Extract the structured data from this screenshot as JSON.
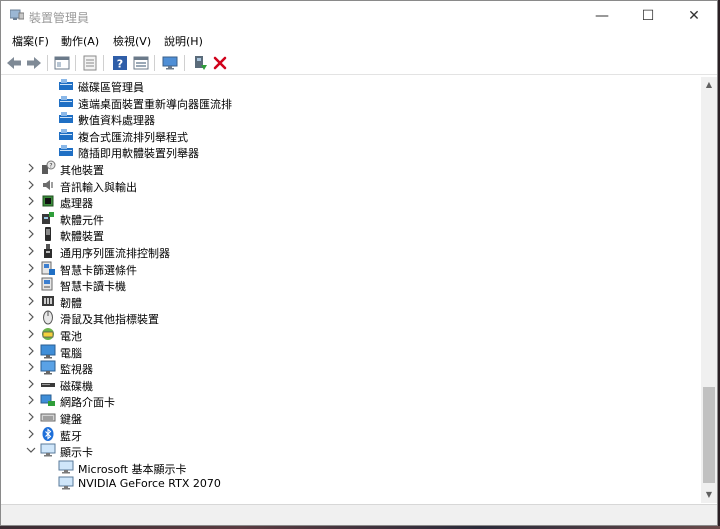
{
  "window": {
    "title": "裝置管理員",
    "minimize_glyph": "—",
    "maximize_glyph": "☐",
    "close_glyph": "✕"
  },
  "menu": [
    "檔案(F)",
    "動作(A)",
    "檢視(V)",
    "說明(H)"
  ],
  "toolbar": {
    "icons": [
      "back-arrow-icon",
      "forward-arrow-icon",
      "show-hide-tree-icon",
      "properties-icon",
      "help-icon",
      "view-icon",
      "monitor-icon",
      "update-driver-icon",
      "uninstall-icon"
    ],
    "uninstall_color": "#d0021b"
  },
  "tree": {
    "rows": [
      {
        "label": "磁碟區管理員",
        "icon": "storage-controller-icon",
        "indent": 2,
        "chevron": "none"
      },
      {
        "label": "遠端桌面裝置重新導向器匯流排",
        "icon": "storage-controller-icon",
        "indent": 2,
        "chevron": "none"
      },
      {
        "label": "數值資料處理器",
        "icon": "storage-controller-icon",
        "indent": 2,
        "chevron": "none"
      },
      {
        "label": "複合式匯流排列舉程式",
        "icon": "storage-controller-icon",
        "indent": 2,
        "chevron": "none"
      },
      {
        "label": "隨插即用軟體裝置列舉器",
        "icon": "storage-controller-icon",
        "indent": 2,
        "chevron": "none"
      },
      {
        "label": "其他裝置",
        "icon": "unknown-device-icon",
        "indent": 1,
        "chevron": "right"
      },
      {
        "label": "音訊輸入與輸出",
        "icon": "speaker-icon",
        "indent": 1,
        "chevron": "right"
      },
      {
        "label": "處理器",
        "icon": "processor-icon",
        "indent": 1,
        "chevron": "right"
      },
      {
        "label": "軟體元件",
        "icon": "software-component-icon",
        "indent": 1,
        "chevron": "right"
      },
      {
        "label": "軟體裝置",
        "icon": "software-device-icon",
        "indent": 1,
        "chevron": "right"
      },
      {
        "label": "通用序列匯流排控制器",
        "icon": "usb-icon",
        "indent": 1,
        "chevron": "right"
      },
      {
        "label": "智慧卡篩選條件",
        "icon": "smart-card-filter-icon",
        "indent": 1,
        "chevron": "right"
      },
      {
        "label": "智慧卡讀卡機",
        "icon": "smart-card-reader-icon",
        "indent": 1,
        "chevron": "right"
      },
      {
        "label": "韌體",
        "icon": "firmware-icon",
        "indent": 1,
        "chevron": "right"
      },
      {
        "label": "滑鼠及其他指標裝置",
        "icon": "mouse-icon",
        "indent": 1,
        "chevron": "right"
      },
      {
        "label": "電池",
        "icon": "battery-icon",
        "indent": 1,
        "chevron": "right"
      },
      {
        "label": "電腦",
        "icon": "computer-icon",
        "indent": 1,
        "chevron": "right"
      },
      {
        "label": "監視器",
        "icon": "monitor-icon",
        "indent": 1,
        "chevron": "right"
      },
      {
        "label": "磁碟機",
        "icon": "disk-drive-icon",
        "indent": 1,
        "chevron": "right"
      },
      {
        "label": "網路介面卡",
        "icon": "network-adapter-icon",
        "indent": 1,
        "chevron": "right"
      },
      {
        "label": "鍵盤",
        "icon": "keyboard-icon",
        "indent": 1,
        "chevron": "right"
      },
      {
        "label": "藍牙",
        "icon": "bluetooth-icon",
        "indent": 1,
        "chevron": "right"
      },
      {
        "label": "顯示卡",
        "icon": "display-adapter-icon",
        "indent": 1,
        "chevron": "down"
      },
      {
        "label": "Microsoft 基本顯示卡",
        "icon": "display-adapter-icon",
        "indent": 2,
        "chevron": "none"
      },
      {
        "label": "NVIDIA GeForce RTX 2070",
        "icon": "display-adapter-icon",
        "indent": 2,
        "chevron": "none"
      }
    ]
  },
  "scrollbar": {
    "up_glyph": "▲",
    "down_glyph": "▼",
    "position_fraction": 0.85
  }
}
